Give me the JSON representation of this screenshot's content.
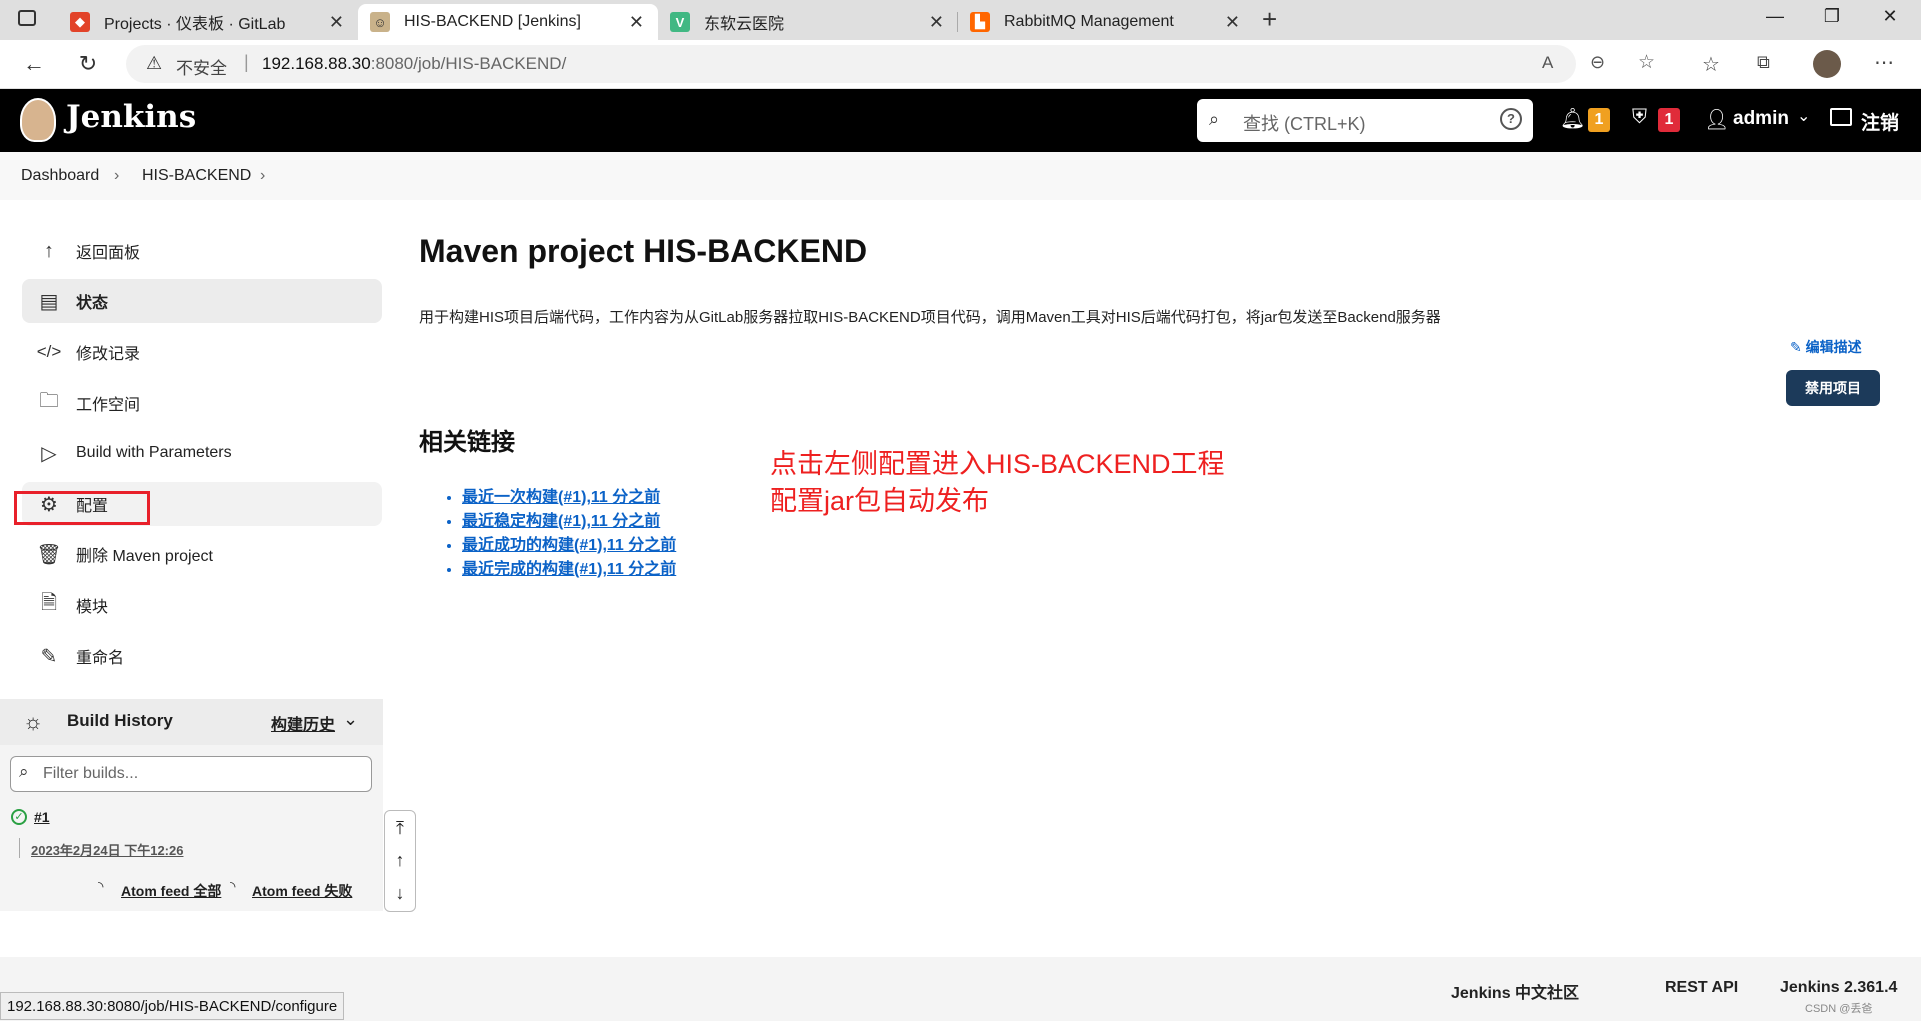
{
  "browser": {
    "tabs": [
      {
        "title": "Projects · 仪表板 · GitLab",
        "icon": "gitlab-icon"
      },
      {
        "title": "HIS-BACKEND [Jenkins]",
        "icon": "jenkins-icon"
      },
      {
        "title": "东软云医院",
        "icon": "vue-icon"
      },
      {
        "title": "RabbitMQ Management",
        "icon": "rabbitmq-icon"
      }
    ],
    "security_label": "不安全",
    "url_host": "192.168.88.30",
    "url_rest": ":8080/job/HIS-BACKEND/"
  },
  "header": {
    "brand": "Jenkins",
    "search_placeholder": "查找 (CTRL+K)",
    "notifications_count": "1",
    "security_count": "1",
    "user": "admin",
    "logout": "注销"
  },
  "breadcrumb": {
    "items": [
      "Dashboard",
      "HIS-BACKEND"
    ]
  },
  "sidebar": {
    "items": [
      {
        "label": "返回面板",
        "icon": "arrow-up-icon"
      },
      {
        "label": "状态",
        "icon": "document-icon"
      },
      {
        "label": "修改记录",
        "icon": "code-icon"
      },
      {
        "label": "工作空间",
        "icon": "folder-icon"
      },
      {
        "label": "Build with Parameters",
        "icon": "play-icon"
      },
      {
        "label": "配置",
        "icon": "gear-icon"
      },
      {
        "label": "删除 Maven project",
        "icon": "trash-icon"
      },
      {
        "label": "模块",
        "icon": "file-icon"
      },
      {
        "label": "重命名",
        "icon": "pencil-icon"
      }
    ]
  },
  "build_history": {
    "title": "Build History",
    "trend_label": "构建历史",
    "filter_placeholder": "Filter builds...",
    "builds": [
      {
        "number": "#1",
        "date": "2023年2月24日 下午12:26"
      }
    ],
    "feed_all": "Atom feed 全部",
    "feed_fail": "Atom feed 失败"
  },
  "main": {
    "title": "Maven project HIS-BACKEND",
    "description": "用于构建HIS项目后端代码，工作内容为从GitLab服务器拉取HIS-BACKEND项目代码，调用Maven工具对HIS后端代码打包，将jar包发送至Backend服务器",
    "edit_description": "编辑描述",
    "disable_button": "禁用项目",
    "links_title": "相关链接",
    "links": [
      "最近一次构建(#1),11 分之前",
      "最近稳定构建(#1),11 分之前",
      "最近成功的构建(#1),11 分之前",
      "最近完成的构建(#1),11 分之前"
    ],
    "annotation_line1": "点击左侧配置进入HIS-BACKEND工程",
    "annotation_line2": "配置jar包自动发布"
  },
  "footer": {
    "community": "Jenkins 中文社区",
    "rest_api": "REST API",
    "version": "Jenkins 2.361.4",
    "watermark": "CSDN @丢爸"
  },
  "status_bar": {
    "url": "192.168.88.30:8080/job/HIS-BACKEND/configure"
  }
}
